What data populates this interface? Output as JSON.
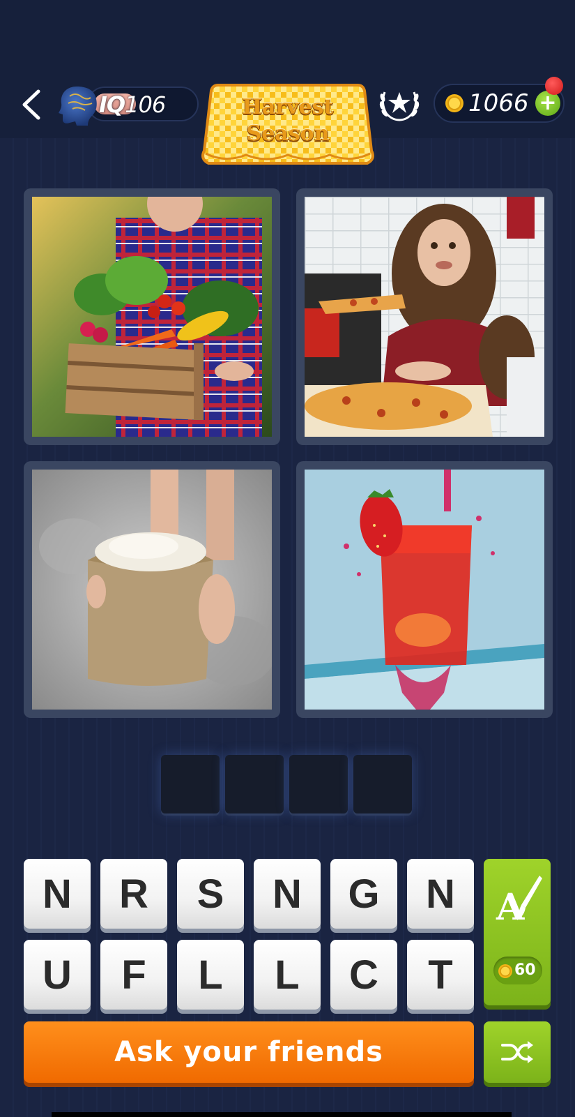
{
  "header": {
    "back_icon": "chevron-left-icon",
    "iq": {
      "label": "IQ",
      "value": "106"
    },
    "banner": {
      "line1": "Harvest",
      "line2": "Season"
    },
    "achievements_icon": "laurel-star-icon",
    "coins": {
      "value": "1066",
      "plus_label": "+"
    }
  },
  "puzzle": {
    "images": [
      {
        "subject": "vegetable-crate"
      },
      {
        "subject": "pizza-eater"
      },
      {
        "subject": "rice-sack"
      },
      {
        "subject": "red-drink-splash"
      }
    ],
    "answer_slots": 4
  },
  "keyboard": {
    "row1": [
      "N",
      "R",
      "S",
      "N",
      "G",
      "N"
    ],
    "row2": [
      "U",
      "F",
      "L",
      "L",
      "C",
      "T"
    ]
  },
  "hint": {
    "letter": "A",
    "cost": "60"
  },
  "actions": {
    "ask_friends_label": "Ask your friends",
    "shuffle_icon": "shuffle-icon"
  },
  "colors": {
    "accent_orange": "#f07a0a",
    "accent_green": "#8cc21f",
    "background": "#1b2543"
  }
}
